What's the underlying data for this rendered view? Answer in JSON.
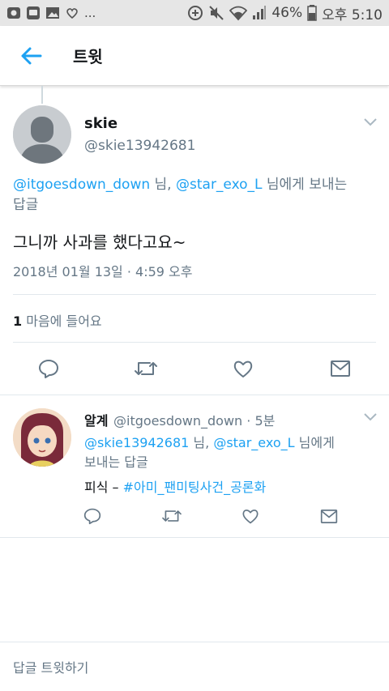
{
  "status_bar": {
    "notif_more": "...",
    "battery": "46%",
    "time": "오후 5:10"
  },
  "header": {
    "title": "트윗"
  },
  "tweet": {
    "author_name": "skie",
    "author_handle": "@skie13942681",
    "reply_mention_1": "@itgoesdown_down",
    "reply_mention_1_suffix": " 님, ",
    "reply_mention_2": "@star_exo_L",
    "reply_to_suffix": " 님에게 보내는",
    "reply_to_line2": "답글",
    "text": "그니까 사과를 했다고요~",
    "date": "2018년 01월 13일 · 4:59 오후",
    "likes_count": "1",
    "likes_label": " 마음에 들어요"
  },
  "reply": {
    "author_name": "알계",
    "author_handle": "@itgoesdown_down",
    "time": " · 5분",
    "mention_1": "@skie13942681",
    "mention_1_suffix": " 님, ",
    "mention_2": "@star_exo_L",
    "mention_suffix": " 님에게",
    "mention_line2": "보내는 답글",
    "text_prefix": "피식 – ",
    "hashtag": "#아미_팬미팅사건_공론화"
  },
  "compose": {
    "placeholder": "답글 트윗하기"
  },
  "colors": {
    "accent": "#1da1f2",
    "secondary_text": "#657786",
    "primary_text": "#14171a",
    "divider": "#e1e8ed"
  },
  "icons": [
    "back-arrow-icon",
    "chevron-down-icon",
    "reply-icon",
    "retweet-icon",
    "like-icon",
    "message-icon"
  ]
}
